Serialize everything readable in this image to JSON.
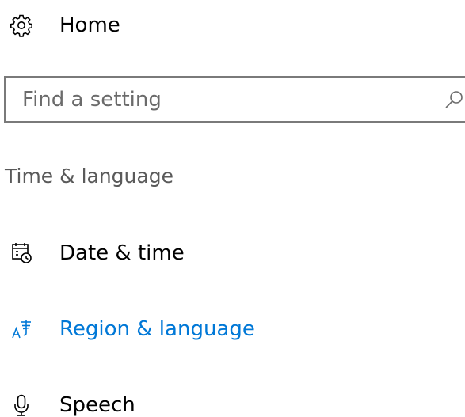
{
  "home": {
    "label": "Home",
    "icon": "gear-icon"
  },
  "search": {
    "placeholder": "Find a setting",
    "value": "",
    "icon": "search-icon"
  },
  "section": {
    "title": "Time & language"
  },
  "nav": {
    "items": [
      {
        "label": "Date & time",
        "icon": "calendar-clock-icon",
        "active": false
      },
      {
        "label": "Region & language",
        "icon": "language-icon",
        "active": true
      },
      {
        "label": "Speech",
        "icon": "microphone-icon",
        "active": false
      }
    ]
  },
  "colors": {
    "accent": "#0078d7",
    "text": "#000000",
    "muted": "#5a5a5a",
    "border": "#7a7a7a"
  }
}
